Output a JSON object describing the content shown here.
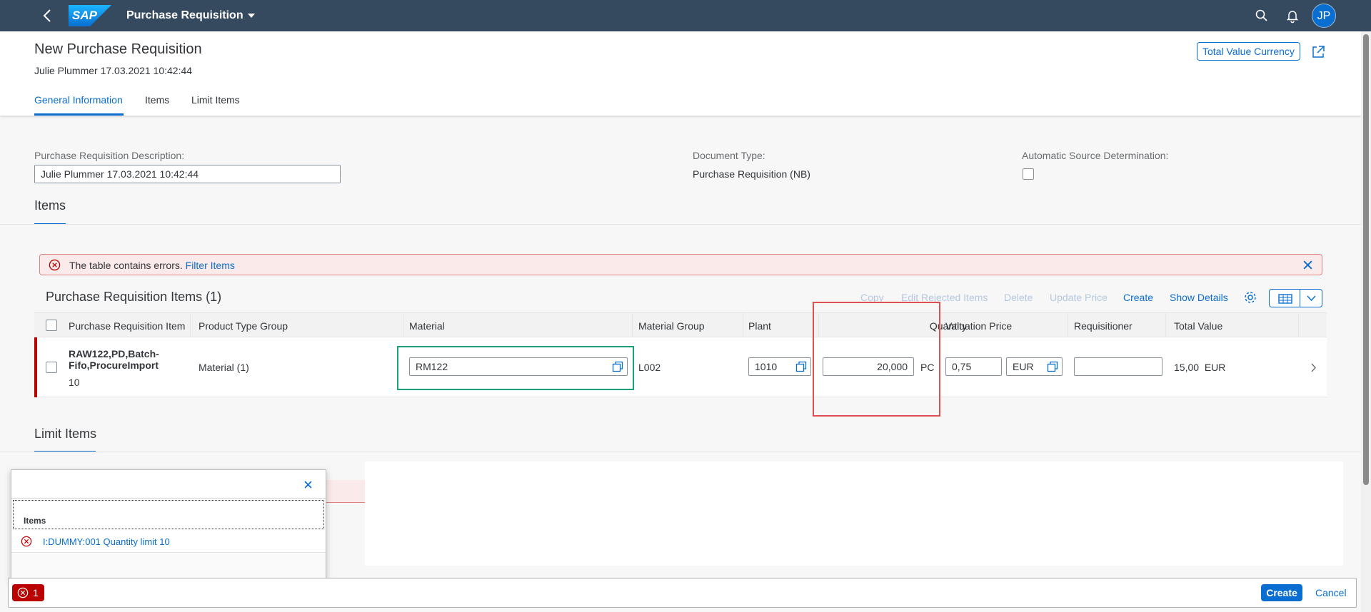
{
  "shell": {
    "logo_text": "SAP",
    "app_title": "Purchase Requisition",
    "avatar_initials": "JP"
  },
  "header": {
    "title": "New Purchase Requisition",
    "subtitle": "Julie Plummer 17.03.2021 10:42:44",
    "total_value_currency_label": "Total Value Currency",
    "tabs": [
      {
        "label": "General Information"
      },
      {
        "label": "Items"
      },
      {
        "label": "Limit Items"
      }
    ]
  },
  "general": {
    "pr_description_label": "Purchase Requisition Description:",
    "pr_description_value": "Julie Plummer 17.03.2021 10:42:44",
    "document_type_label": "Document Type:",
    "document_type_value": "Purchase Requisition (NB)",
    "auto_source_label": "Automatic Source Determination:"
  },
  "items_section": {
    "title": "Items",
    "message": {
      "text": "The table contains errors.",
      "link": "Filter Items"
    },
    "table_title": "Purchase Requisition Items (1)",
    "toolbar": {
      "copy": "Copy",
      "edit_rejected": "Edit Rejected Items",
      "delete": "Delete",
      "update_price": "Update Price",
      "create": "Create",
      "show_details": "Show Details"
    },
    "columns": [
      "Purchase Requisition Item",
      "Product Type Group",
      "Material",
      "Material Group",
      "Plant",
      "Quantity",
      "Valuation Price",
      "Requisitioner",
      "Total Value"
    ],
    "row": {
      "item_name_line1": "RAW122,PD,Batch-",
      "item_name_line2": "Fifo,ProcureImport",
      "item_number": "10",
      "product_type_group": "Material (1)",
      "material": "RM122",
      "material_group": "L002",
      "plant": "1010",
      "quantity": "20,000",
      "unit": "PC",
      "valuation_price": "0,75",
      "currency": "EUR",
      "requisitioner": "",
      "total_value": "15,00",
      "total_currency": "EUR"
    }
  },
  "limit_section": {
    "title": "Limit Items"
  },
  "popover": {
    "group_title": "Items",
    "message": "I:DUMMY:001 Quantity limit 10"
  },
  "footer": {
    "error_count": "1",
    "create": "Create",
    "cancel": "Cancel"
  },
  "colors": {
    "shell": "#354a5f",
    "brand": "#0a6ed1",
    "error": "#bb0000",
    "annotation_red": "#e05050",
    "annotation_green": "#1aa37a"
  }
}
